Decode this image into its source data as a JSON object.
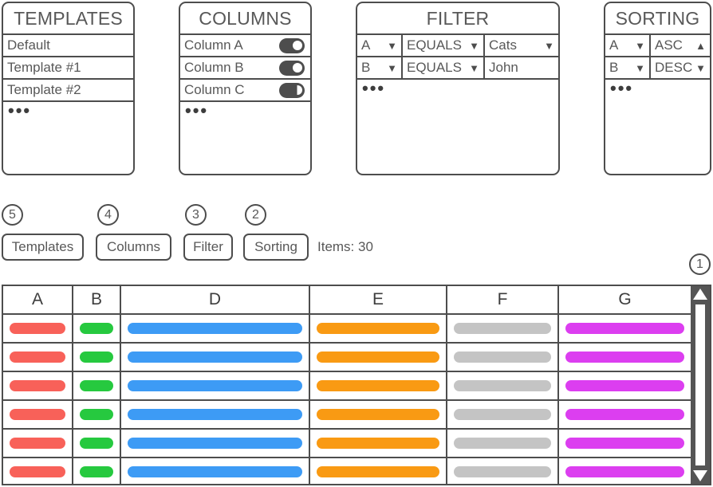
{
  "panels": {
    "templates": {
      "title": "TEMPLATES",
      "items": [
        {
          "label": "Default"
        },
        {
          "label": "Template #1"
        },
        {
          "label": "Template #2"
        }
      ],
      "more": "•••"
    },
    "columns": {
      "title": "COLUMNS",
      "items": [
        {
          "label": "Column A",
          "enabled": true
        },
        {
          "label": "Column B",
          "enabled": true
        },
        {
          "label": "Column C",
          "enabled": false
        }
      ],
      "more": "•••"
    },
    "filter": {
      "title": "FILTER",
      "rows": [
        {
          "field": "A",
          "operator": "EQUALS",
          "value": "Cats",
          "value_is_dropdown": true
        },
        {
          "field": "B",
          "operator": "EQUALS",
          "value": "John",
          "value_is_dropdown": false
        }
      ],
      "more": "•••",
      "caret_down": "▼"
    },
    "sorting": {
      "title": "SORTING",
      "rows": [
        {
          "field": "A",
          "direction": "ASC",
          "arrow": "▲"
        },
        {
          "field": "B",
          "direction": "DESC",
          "arrow": "▼"
        }
      ],
      "more": "•••",
      "caret_down": "▼"
    }
  },
  "toolbar": {
    "buttons": [
      {
        "label": "Templates",
        "marker": "5"
      },
      {
        "label": "Columns",
        "marker": "4"
      },
      {
        "label": "Filter",
        "marker": "3"
      },
      {
        "label": "Sorting",
        "marker": "2"
      }
    ],
    "items_count_label": "Items: 30"
  },
  "table": {
    "marker": "1",
    "columns": [
      {
        "label": "A",
        "color": "#f86159"
      },
      {
        "label": "B",
        "color": "#26c93f"
      },
      {
        "label": "D",
        "color": "#3d9bf5"
      },
      {
        "label": "E",
        "color": "#f99a13"
      },
      {
        "label": "F",
        "color": "#c4c4c4"
      },
      {
        "label": "G",
        "color": "#dc3ef0"
      }
    ],
    "row_count": 6,
    "scrollbar": {
      "up_arrow": "▲",
      "down_arrow": "▼"
    }
  }
}
